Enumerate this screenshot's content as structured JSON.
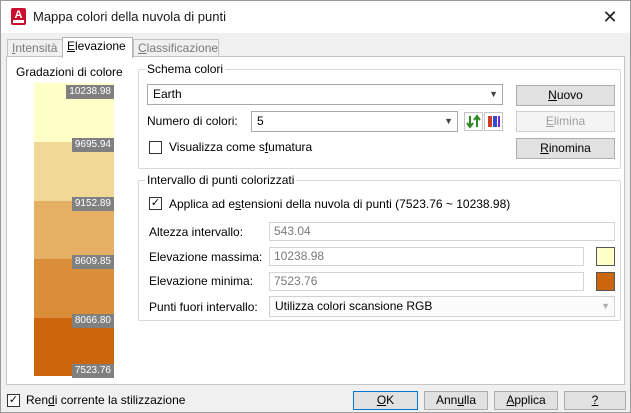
{
  "window": {
    "title": "Mappa colori della nuvola di punti",
    "app_icon_letter": "A"
  },
  "tabs": [
    {
      "label_pre": "",
      "label_u": "I",
      "label_post": "ntensità"
    },
    {
      "label_pre": "",
      "label_u": "E",
      "label_post": "levazione"
    },
    {
      "label_pre": "",
      "label_u": "C",
      "label_post": "lassificazione"
    }
  ],
  "gradations": {
    "title": "Gradazioni di colore",
    "bands": [
      {
        "color": "#ffffc8",
        "label": "10238.98"
      },
      {
        "color": "#f2d896",
        "label": "9695.94"
      },
      {
        "color": "#e6b064",
        "label": "9152.89"
      },
      {
        "color": "#d98e37",
        "label": "8609.85"
      },
      {
        "color": "#cc660e",
        "label": "8066.80"
      },
      {
        "color": "",
        "label": "7523.76"
      }
    ]
  },
  "color_scheme": {
    "title": "Schema colori",
    "selected": "Earth",
    "num_colors_label_pre": "Numero di colori:",
    "num_colors_value": "5",
    "gradient_label_pre": "Visualizza come s",
    "gradient_label_u": "f",
    "gradient_label_post": "umatura",
    "gradient_checked": false,
    "new_btn_u": "N",
    "new_btn_post": "uovo",
    "delete_btn_u": "E",
    "delete_btn_post": "limina",
    "rename_btn_u": "R",
    "rename_btn_post": "inomina"
  },
  "range": {
    "title": "Intervallo di punti colorizzati",
    "apply_label_pre": "Applica ad e",
    "apply_label_u": "s",
    "apply_label_post": "tensioni della nuvola di punti",
    "apply_range_text": "(7523.76 ~ 10238.98)",
    "apply_checked": true,
    "interval_height_label": "Altezza intervallo:",
    "interval_height_value": "543.04",
    "max_elev_label": "Elevazione massima:",
    "max_elev_value": "10238.98",
    "max_color": "#ffffc8",
    "min_elev_label": "Elevazione minima:",
    "min_elev_value": "7523.76",
    "min_color": "#cc660e",
    "out_of_range_label": "Punti fuori intervallo:",
    "out_of_range_value": "Utilizza colori scansione RGB"
  },
  "footer": {
    "current_style_pre": "Ren",
    "current_style_u": "d",
    "current_style_post": "i corrente la stilizzazione",
    "current_style_checked": true,
    "ok_u": "O",
    "ok_post": "K",
    "cancel_pre": "Ann",
    "cancel_u": "u",
    "cancel_post": "lla",
    "apply_pre": "",
    "apply_u": "A",
    "apply_post": "pplica",
    "help_u": "?"
  }
}
